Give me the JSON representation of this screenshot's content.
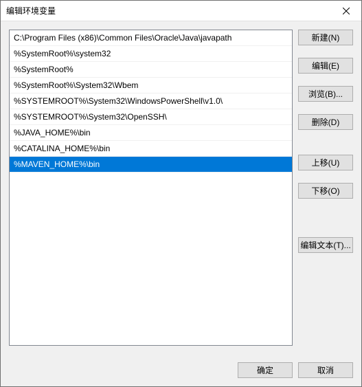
{
  "title": "编辑环境变量",
  "list": {
    "items": [
      "C:\\Program Files (x86)\\Common Files\\Oracle\\Java\\javapath",
      "%SystemRoot%\\system32",
      "%SystemRoot%",
      "%SystemRoot%\\System32\\Wbem",
      "%SYSTEMROOT%\\System32\\WindowsPowerShell\\v1.0\\",
      "%SYSTEMROOT%\\System32\\OpenSSH\\",
      "%JAVA_HOME%\\bin",
      "%CATALINA_HOME%\\bin",
      "%MAVEN_HOME%\\bin"
    ],
    "selected_index": 8
  },
  "buttons": {
    "new": "新建(N)",
    "edit": "编辑(E)",
    "browse": "浏览(B)...",
    "delete": "删除(D)",
    "move_up": "上移(U)",
    "move_down": "下移(O)",
    "edit_text": "编辑文本(T)...",
    "ok": "确定",
    "cancel": "取消"
  }
}
